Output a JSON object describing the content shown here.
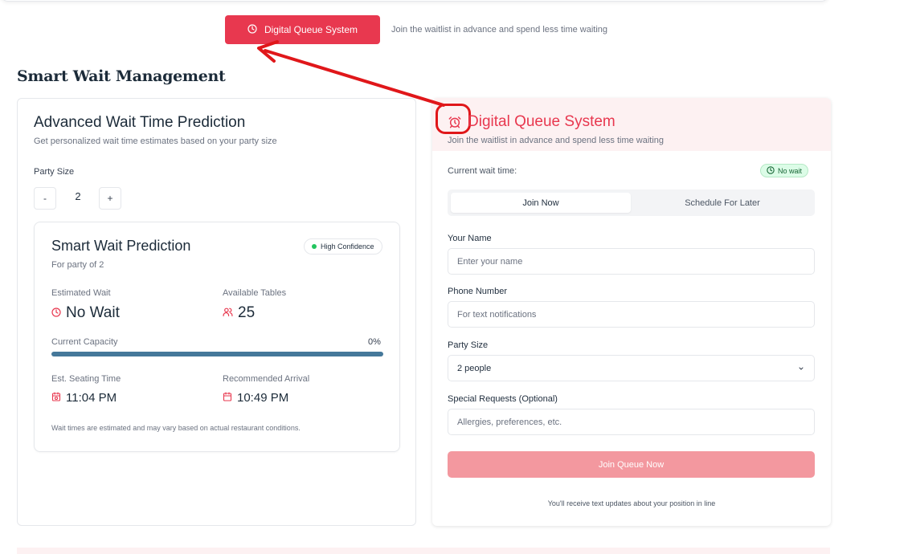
{
  "top_button": {
    "label": "Digital Queue System",
    "icon": "clock-icon"
  },
  "top_tagline": "Join the waitlist in advance and spend less time waiting",
  "section_title": "Smart Wait Management",
  "prediction": {
    "title": "Advanced Wait Time Prediction",
    "subtitle": "Get personalized wait time estimates based on your party size",
    "party_size_label": "Party Size",
    "decrement_label": "-",
    "increment_label": "+",
    "party_size_value": "2",
    "card": {
      "title": "Smart Wait Prediction",
      "subtitle": "For party of 2",
      "confidence_badge": "High Confidence",
      "estimated_wait_label": "Estimated Wait",
      "estimated_wait_value": "No Wait",
      "available_tables_label": "Available Tables",
      "available_tables_value": "25",
      "capacity_label": "Current Capacity",
      "capacity_value": "0%",
      "seating_label": "Est. Seating Time",
      "seating_value": "11:04 PM",
      "arrival_label": "Recommended Arrival",
      "arrival_value": "10:49 PM",
      "note": "Wait times are estimated and may vary based on actual restaurant conditions."
    }
  },
  "queue": {
    "title": "Digital Queue System",
    "subtitle": "Join the waitlist in advance and spend less time waiting",
    "current_wait_label": "Current wait time:",
    "current_wait_badge": "No wait",
    "tabs": [
      {
        "label": "Join Now",
        "active": true
      },
      {
        "label": "Schedule For Later",
        "active": false
      }
    ],
    "fields": {
      "name_label": "Your Name",
      "name_placeholder": "Enter your name",
      "phone_label": "Phone Number",
      "phone_placeholder": "For text notifications",
      "party_label": "Party Size",
      "party_value": "2 people",
      "requests_label": "Special Requests (Optional)",
      "requests_placeholder": "Allergies, preferences, etc."
    },
    "submit_label": "Join Queue Now",
    "footer_note": "You'll receive text updates about your position in line"
  },
  "colors": {
    "accent": "#e8384f",
    "accent_light": "#f3989f",
    "bar": "#45789a",
    "annotation": "#e0171a"
  }
}
